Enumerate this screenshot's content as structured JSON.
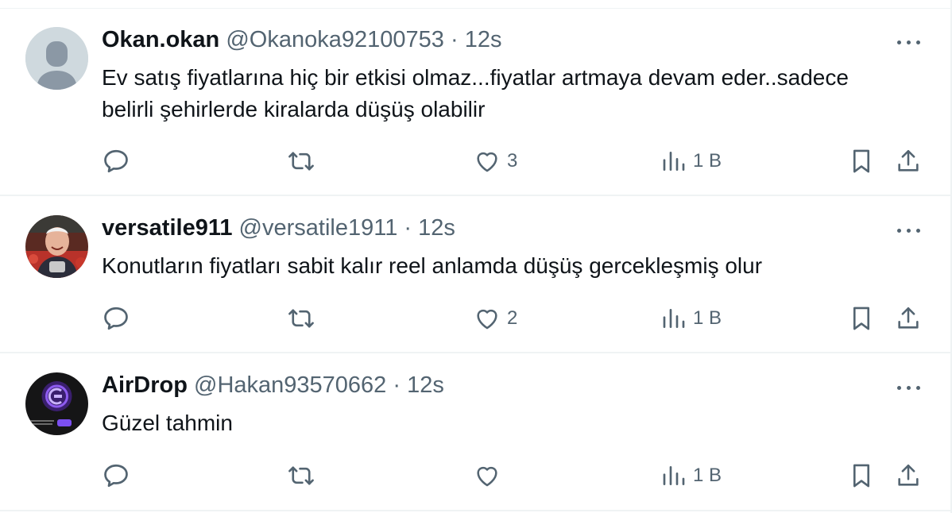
{
  "tweets": [
    {
      "display_name": "Okan.okan",
      "handle": "@Okanoka92100753",
      "separator": "·",
      "time": "12s",
      "text_lines": [
        "Ev satış fiyatlarına hiç bir etkisi olmaz...fiyatlar artmaya devam eder..sadece",
        "belirli şehirlerde kiralarda düşüş olabilir"
      ],
      "likes": "3",
      "views": "1 B",
      "avatar": "default-avatar"
    },
    {
      "display_name": "versatile911",
      "handle": "@versatile1911",
      "separator": "·",
      "time": "12s",
      "text_lines": [
        "Konutların fiyatları sabit kalır reel anlamda düşüş gercekleşmiş olur"
      ],
      "likes": "2",
      "views": "1 B",
      "avatar": "photo-avatar"
    },
    {
      "display_name": "AirDrop",
      "handle": "@Hakan93570662",
      "separator": "·",
      "time": "12s",
      "text_lines": [
        "Güzel tahmin"
      ],
      "likes": "",
      "views": "1 B",
      "avatar": "logo-avatar"
    }
  ],
  "colors": {
    "text_primary": "#0f1419",
    "text_secondary": "#536471",
    "divider": "#eff3f4"
  }
}
